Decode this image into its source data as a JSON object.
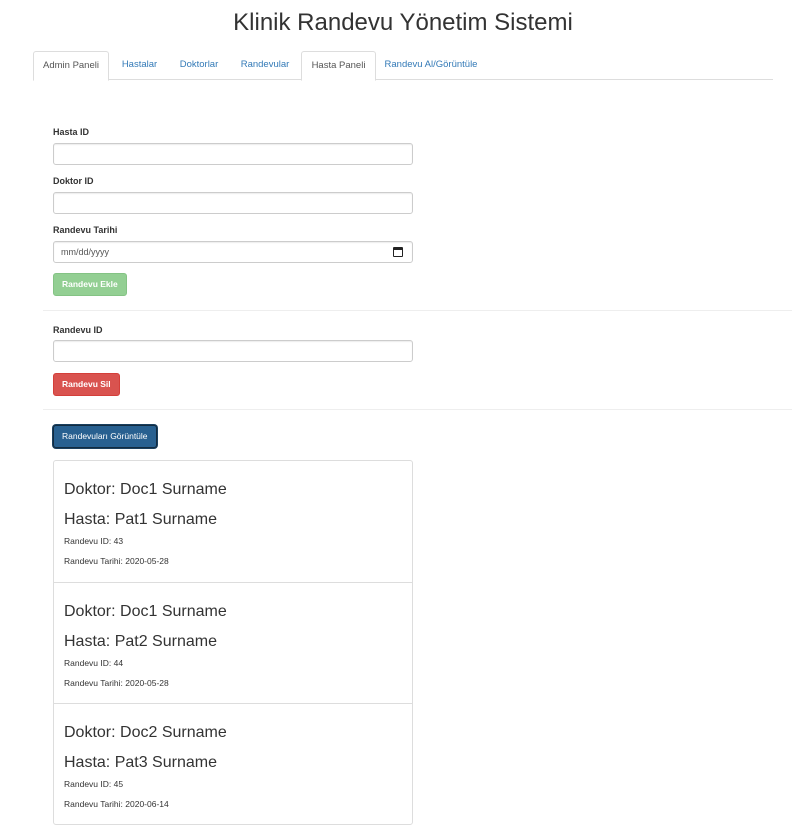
{
  "header": {
    "title": "Klinik Randevu Yönetim Sistemi"
  },
  "tabs": [
    {
      "label": "Admin Paneli"
    },
    {
      "label": "Hastalar"
    },
    {
      "label": "Doktorlar"
    },
    {
      "label": "Randevular"
    },
    {
      "label": "Hasta Paneli"
    },
    {
      "label": "Randevu Al/Görüntüle"
    }
  ],
  "add_form": {
    "patient_id_label": "Hasta ID",
    "patient_id_value": "",
    "doctor_id_label": "Doktor ID",
    "doctor_id_value": "",
    "date_label": "Randevu Tarihi",
    "date_placeholder": "mm/dd/yyyy",
    "submit_label": "Randevu Ekle"
  },
  "delete_form": {
    "appointment_id_label": "Randevu ID",
    "appointment_id_value": "",
    "submit_label": "Randevu Sil"
  },
  "view_button_label": "Randevuları Görüntüle",
  "appointments": [
    {
      "doctor": "Doktor: Doc1 Surname",
      "patient": "Hasta: Pat1 Surname",
      "id": "Randevu ID: 43",
      "date": "Randevu Tarihi: 2020-05-28"
    },
    {
      "doctor": "Doktor: Doc1 Surname",
      "patient": "Hasta: Pat2 Surname",
      "id": "Randevu ID: 44",
      "date": "Randevu Tarihi: 2020-05-28"
    },
    {
      "doctor": "Doktor: Doc2 Surname",
      "patient": "Hasta: Pat3 Surname",
      "id": "Randevu ID: 45",
      "date": "Randevu Tarihi: 2020-06-14"
    }
  ],
  "colors": {
    "link": "#337ab7",
    "success_disabled": "#93cf93",
    "danger": "#d9534f",
    "primary": "#286090"
  }
}
